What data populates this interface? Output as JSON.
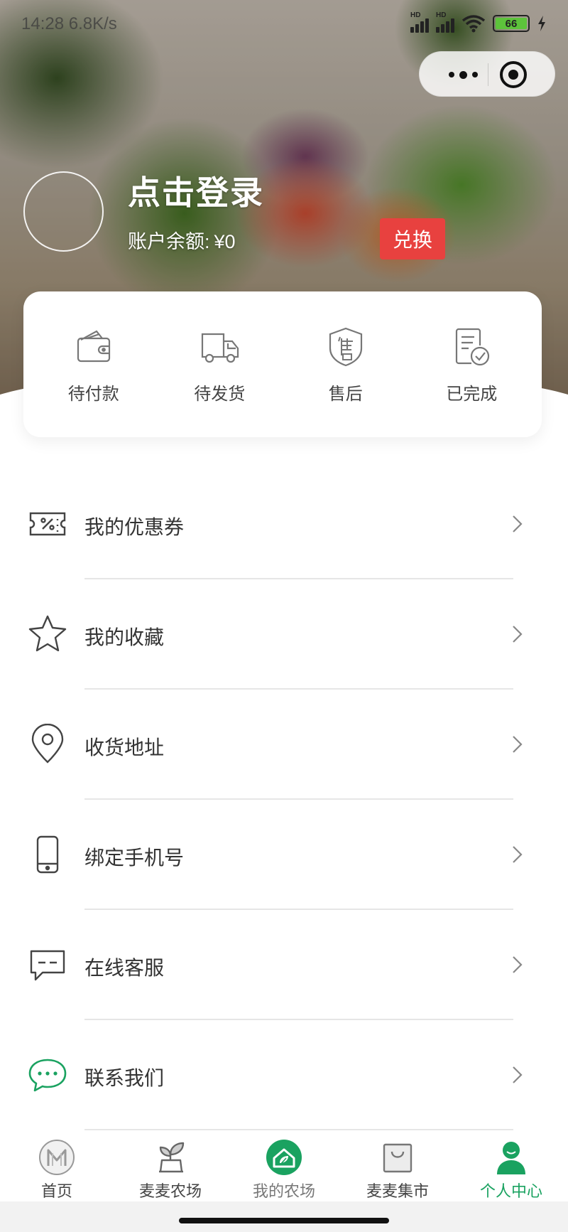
{
  "status_bar": {
    "time": "14:28 6.8K/s",
    "battery": "66"
  },
  "header": {
    "login_text": "点击登录",
    "balance_label": "账户余额:",
    "balance_value": "¥0",
    "exchange_label": "兑换"
  },
  "orders": [
    {
      "label": "待付款",
      "icon": "wallet-icon"
    },
    {
      "label": "待发货",
      "icon": "truck-icon"
    },
    {
      "label": "售后",
      "icon": "after-sales-shield-icon"
    },
    {
      "label": "已完成",
      "icon": "completed-doc-icon"
    }
  ],
  "menu": [
    {
      "label": "我的优惠券",
      "icon": "coupon-icon"
    },
    {
      "label": "我的收藏",
      "icon": "star-icon"
    },
    {
      "label": "收货地址",
      "icon": "location-pin-icon"
    },
    {
      "label": "绑定手机号",
      "icon": "phone-icon"
    },
    {
      "label": "在线客服",
      "icon": "chat-bubble-icon"
    },
    {
      "label": "联系我们",
      "icon": "message-dots-icon"
    }
  ],
  "tabbar": [
    {
      "label": "首页",
      "icon": "home-logo-icon"
    },
    {
      "label": "麦麦农场",
      "icon": "sprout-icon"
    },
    {
      "label": "我的农场",
      "icon": "my-farm-icon"
    },
    {
      "label": "麦麦集市",
      "icon": "shopping-bag-icon"
    },
    {
      "label": "个人中心",
      "icon": "person-icon",
      "active": true
    }
  ],
  "colors": {
    "accent_green": "#1aa260",
    "exchange_red": "#e8413f"
  }
}
